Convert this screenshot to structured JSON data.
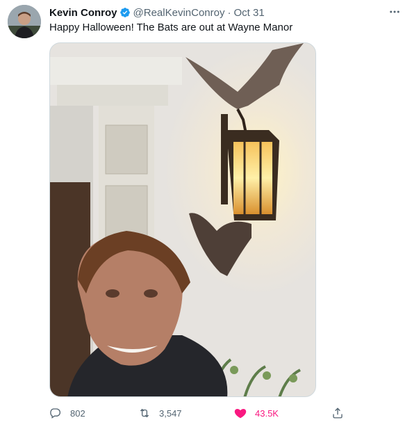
{
  "tweet": {
    "author_name": "Kevin Conroy",
    "handle": "@RealKevinConroy",
    "separator": "·",
    "time": "Oct 31",
    "text": "Happy Halloween! The Bats are out at Wayne Manor",
    "verified_color": "#1d9bf0"
  },
  "actions": {
    "reply_count": "802",
    "retweet_count": "3,547",
    "like_count": "43.5K",
    "like_color": "#f91880"
  },
  "icons": {
    "more": "more-horizontal-icon",
    "reply": "reply-icon",
    "retweet": "retweet-icon",
    "like": "heart-icon",
    "share": "share-icon"
  }
}
